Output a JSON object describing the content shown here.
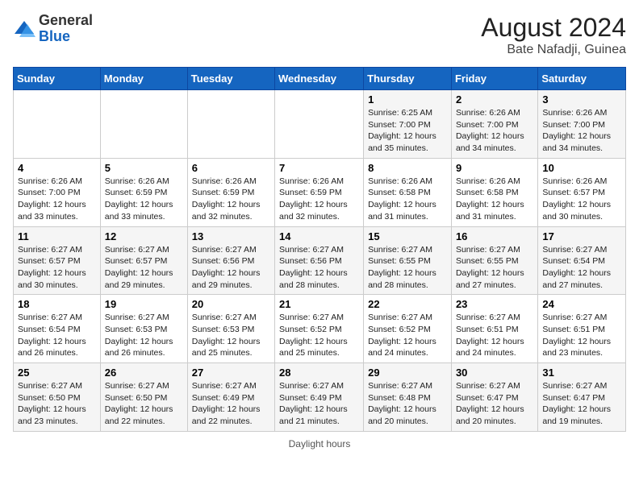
{
  "header": {
    "logo_general": "General",
    "logo_blue": "Blue",
    "month_year": "August 2024",
    "location": "Bate Nafadji, Guinea"
  },
  "days_of_week": [
    "Sunday",
    "Monday",
    "Tuesday",
    "Wednesday",
    "Thursday",
    "Friday",
    "Saturday"
  ],
  "weeks": [
    [
      {
        "day": "",
        "content": ""
      },
      {
        "day": "",
        "content": ""
      },
      {
        "day": "",
        "content": ""
      },
      {
        "day": "",
        "content": ""
      },
      {
        "day": "1",
        "content": "Sunrise: 6:25 AM\nSunset: 7:00 PM\nDaylight: 12 hours\nand 35 minutes."
      },
      {
        "day": "2",
        "content": "Sunrise: 6:26 AM\nSunset: 7:00 PM\nDaylight: 12 hours\nand 34 minutes."
      },
      {
        "day": "3",
        "content": "Sunrise: 6:26 AM\nSunset: 7:00 PM\nDaylight: 12 hours\nand 34 minutes."
      }
    ],
    [
      {
        "day": "4",
        "content": "Sunrise: 6:26 AM\nSunset: 7:00 PM\nDaylight: 12 hours\nand 33 minutes."
      },
      {
        "day": "5",
        "content": "Sunrise: 6:26 AM\nSunset: 6:59 PM\nDaylight: 12 hours\nand 33 minutes."
      },
      {
        "day": "6",
        "content": "Sunrise: 6:26 AM\nSunset: 6:59 PM\nDaylight: 12 hours\nand 32 minutes."
      },
      {
        "day": "7",
        "content": "Sunrise: 6:26 AM\nSunset: 6:59 PM\nDaylight: 12 hours\nand 32 minutes."
      },
      {
        "day": "8",
        "content": "Sunrise: 6:26 AM\nSunset: 6:58 PM\nDaylight: 12 hours\nand 31 minutes."
      },
      {
        "day": "9",
        "content": "Sunrise: 6:26 AM\nSunset: 6:58 PM\nDaylight: 12 hours\nand 31 minutes."
      },
      {
        "day": "10",
        "content": "Sunrise: 6:26 AM\nSunset: 6:57 PM\nDaylight: 12 hours\nand 30 minutes."
      }
    ],
    [
      {
        "day": "11",
        "content": "Sunrise: 6:27 AM\nSunset: 6:57 PM\nDaylight: 12 hours\nand 30 minutes."
      },
      {
        "day": "12",
        "content": "Sunrise: 6:27 AM\nSunset: 6:57 PM\nDaylight: 12 hours\nand 29 minutes."
      },
      {
        "day": "13",
        "content": "Sunrise: 6:27 AM\nSunset: 6:56 PM\nDaylight: 12 hours\nand 29 minutes."
      },
      {
        "day": "14",
        "content": "Sunrise: 6:27 AM\nSunset: 6:56 PM\nDaylight: 12 hours\nand 28 minutes."
      },
      {
        "day": "15",
        "content": "Sunrise: 6:27 AM\nSunset: 6:55 PM\nDaylight: 12 hours\nand 28 minutes."
      },
      {
        "day": "16",
        "content": "Sunrise: 6:27 AM\nSunset: 6:55 PM\nDaylight: 12 hours\nand 27 minutes."
      },
      {
        "day": "17",
        "content": "Sunrise: 6:27 AM\nSunset: 6:54 PM\nDaylight: 12 hours\nand 27 minutes."
      }
    ],
    [
      {
        "day": "18",
        "content": "Sunrise: 6:27 AM\nSunset: 6:54 PM\nDaylight: 12 hours\nand 26 minutes."
      },
      {
        "day": "19",
        "content": "Sunrise: 6:27 AM\nSunset: 6:53 PM\nDaylight: 12 hours\nand 26 minutes."
      },
      {
        "day": "20",
        "content": "Sunrise: 6:27 AM\nSunset: 6:53 PM\nDaylight: 12 hours\nand 25 minutes."
      },
      {
        "day": "21",
        "content": "Sunrise: 6:27 AM\nSunset: 6:52 PM\nDaylight: 12 hours\nand 25 minutes."
      },
      {
        "day": "22",
        "content": "Sunrise: 6:27 AM\nSunset: 6:52 PM\nDaylight: 12 hours\nand 24 minutes."
      },
      {
        "day": "23",
        "content": "Sunrise: 6:27 AM\nSunset: 6:51 PM\nDaylight: 12 hours\nand 24 minutes."
      },
      {
        "day": "24",
        "content": "Sunrise: 6:27 AM\nSunset: 6:51 PM\nDaylight: 12 hours\nand 23 minutes."
      }
    ],
    [
      {
        "day": "25",
        "content": "Sunrise: 6:27 AM\nSunset: 6:50 PM\nDaylight: 12 hours\nand 23 minutes."
      },
      {
        "day": "26",
        "content": "Sunrise: 6:27 AM\nSunset: 6:50 PM\nDaylight: 12 hours\nand 22 minutes."
      },
      {
        "day": "27",
        "content": "Sunrise: 6:27 AM\nSunset: 6:49 PM\nDaylight: 12 hours\nand 22 minutes."
      },
      {
        "day": "28",
        "content": "Sunrise: 6:27 AM\nSunset: 6:49 PM\nDaylight: 12 hours\nand 21 minutes."
      },
      {
        "day": "29",
        "content": "Sunrise: 6:27 AM\nSunset: 6:48 PM\nDaylight: 12 hours\nand 20 minutes."
      },
      {
        "day": "30",
        "content": "Sunrise: 6:27 AM\nSunset: 6:47 PM\nDaylight: 12 hours\nand 20 minutes."
      },
      {
        "day": "31",
        "content": "Sunrise: 6:27 AM\nSunset: 6:47 PM\nDaylight: 12 hours\nand 19 minutes."
      }
    ]
  ],
  "footer": {
    "daylight_label": "Daylight hours"
  }
}
